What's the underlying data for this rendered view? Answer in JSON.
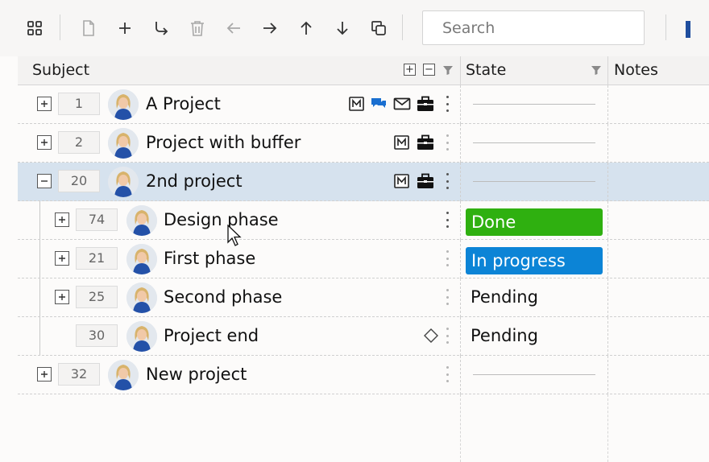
{
  "toolbar": {
    "icons": [
      "grid-icon",
      "new-document-icon",
      "add-icon",
      "indent-icon",
      "delete-icon",
      "arrow-left-icon",
      "arrow-right-icon",
      "arrow-up-icon",
      "arrow-down-icon",
      "copy-icon"
    ],
    "search_placeholder": "Search",
    "accent": "#1f4e9e"
  },
  "columns": {
    "subject": "Subject",
    "state": "State",
    "notes": "Notes"
  },
  "colors": {
    "done": "#2fb010",
    "in_progress": "#0c84d6",
    "selected_row": "#d6e2ee",
    "chat_icon": "#1a6fd0"
  },
  "rows": [
    {
      "id": "1",
      "subject": "A Project",
      "state": "",
      "icons": [
        "m-icon",
        "chat-icon",
        "mail-icon",
        "briefcase-icon"
      ],
      "expand": "+",
      "level": 0
    },
    {
      "id": "2",
      "subject": "Project with buffer",
      "state": "",
      "icons": [
        "m-icon",
        "briefcase-icon"
      ],
      "expand": "+",
      "level": 0
    },
    {
      "id": "20",
      "subject": "2nd project",
      "state": "",
      "icons": [
        "m-icon",
        "briefcase-icon"
      ],
      "expand": "−",
      "level": 0,
      "selected": true
    },
    {
      "id": "74",
      "subject": "Design phase",
      "state": "Done",
      "icons": [],
      "expand": "+",
      "level": 1
    },
    {
      "id": "21",
      "subject": "First phase",
      "state": "In progress",
      "icons": [],
      "expand": "+",
      "level": 1
    },
    {
      "id": "25",
      "subject": "Second phase",
      "state": "Pending",
      "icons": [],
      "expand": "+",
      "level": 1
    },
    {
      "id": "30",
      "subject": "Project end",
      "state": "Pending",
      "icons": [
        "milestone-icon"
      ],
      "expand": "",
      "level": 1
    },
    {
      "id": "32",
      "subject": "New project",
      "state": "",
      "icons": [],
      "expand": "+",
      "level": 0
    }
  ]
}
